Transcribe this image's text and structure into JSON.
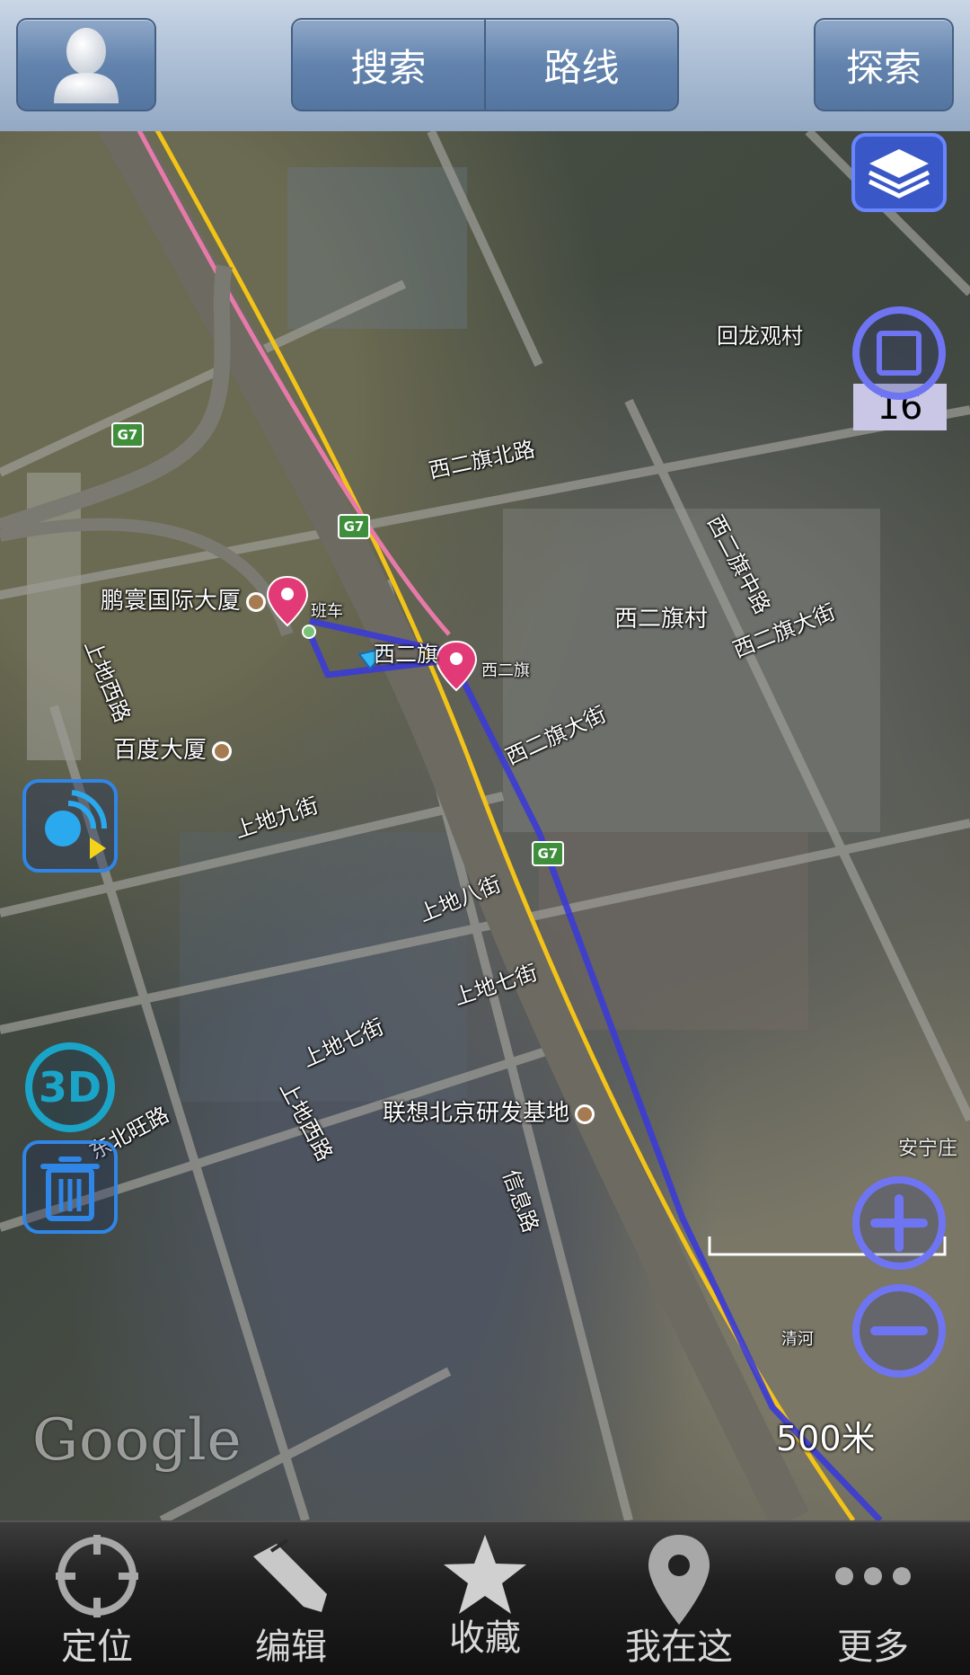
{
  "topbar": {
    "search_label": "搜索",
    "route_label": "路线",
    "explore_label": "探索"
  },
  "map": {
    "zoom_level": "16",
    "scale": "500米",
    "attribution": "Google",
    "labels": {
      "huilongguan": "回龙观村",
      "xierqi_north_road": "西二旗北路",
      "xierqi_middle_road": "西二旗中路",
      "xierqi_village": "西二旗村",
      "xierqi_avenue_east": "西二旗大街",
      "xierqi_avenue": "西二旗大街",
      "shangdi_west_road_1": "上地西路",
      "shangdi_west_road_2": "上地西路",
      "shangdi_9th": "上地九街",
      "shangdi_8th": "上地八街",
      "shangdi_7th_a": "上地七街",
      "shangdi_7th_b": "上地七街",
      "dongbeiwang_road": "东北旺路",
      "xinxi_road": "信息路",
      "banche": "班车",
      "xierqi_station": "西二旗",
      "xierqi_small": "西二旗",
      "qinghe": "清河",
      "anning_partial": "安宁庄",
      "g7_a": "G7",
      "g7_b": "G7",
      "g7_c": "G7"
    },
    "pois": {
      "pengyuan": "鹏寰国际大厦",
      "baidu": "百度大厦",
      "lenovo": "联想北京研发基地"
    },
    "controls": {
      "mode_3d": "3D"
    }
  },
  "bottombar": {
    "locate": "定位",
    "edit": "编辑",
    "favorites": "收藏",
    "here": "我在这",
    "more": "更多"
  },
  "colors": {
    "route": "#3b3bd6",
    "rail_yellow": "#f2c318",
    "rail_pink": "#e77aa8",
    "control_blue": "#5b6ef2",
    "left_control_blue": "#2f86e6"
  }
}
